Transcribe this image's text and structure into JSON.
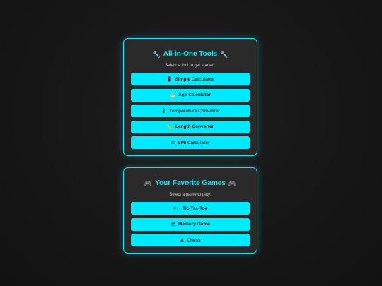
{
  "tools": {
    "title": "All-in-One Tools",
    "title_icon": "wrench-icon",
    "subtitle": "Select a tool to get started:",
    "buttons": [
      {
        "label": "Simple Calculator",
        "icon": "phone-icon"
      },
      {
        "label": "Age Calculator",
        "icon": "cake-icon"
      },
      {
        "label": "Temperature Converter",
        "icon": "thermometer-icon"
      },
      {
        "label": "Length Converter",
        "icon": "ruler-icon"
      },
      {
        "label": "BMI Calculator",
        "icon": "scale-icon"
      }
    ]
  },
  "games": {
    "title": "Your Favorite Games",
    "title_icon": "gamepad-icon",
    "subtitle": "Select a game to play:",
    "buttons": [
      {
        "label": "Tic-Tac-Toe",
        "icon": "x-o-icon"
      },
      {
        "label": "Memory Game",
        "icon": "sunglasses-face-icon"
      },
      {
        "label": "Chess",
        "icon": "chess-pawn-icon"
      }
    ]
  },
  "colors": {
    "accent": "#19e6f5",
    "button_bg": "#00eaff",
    "panel_bg": "#2a2a2a",
    "page_bg": "#161616"
  }
}
